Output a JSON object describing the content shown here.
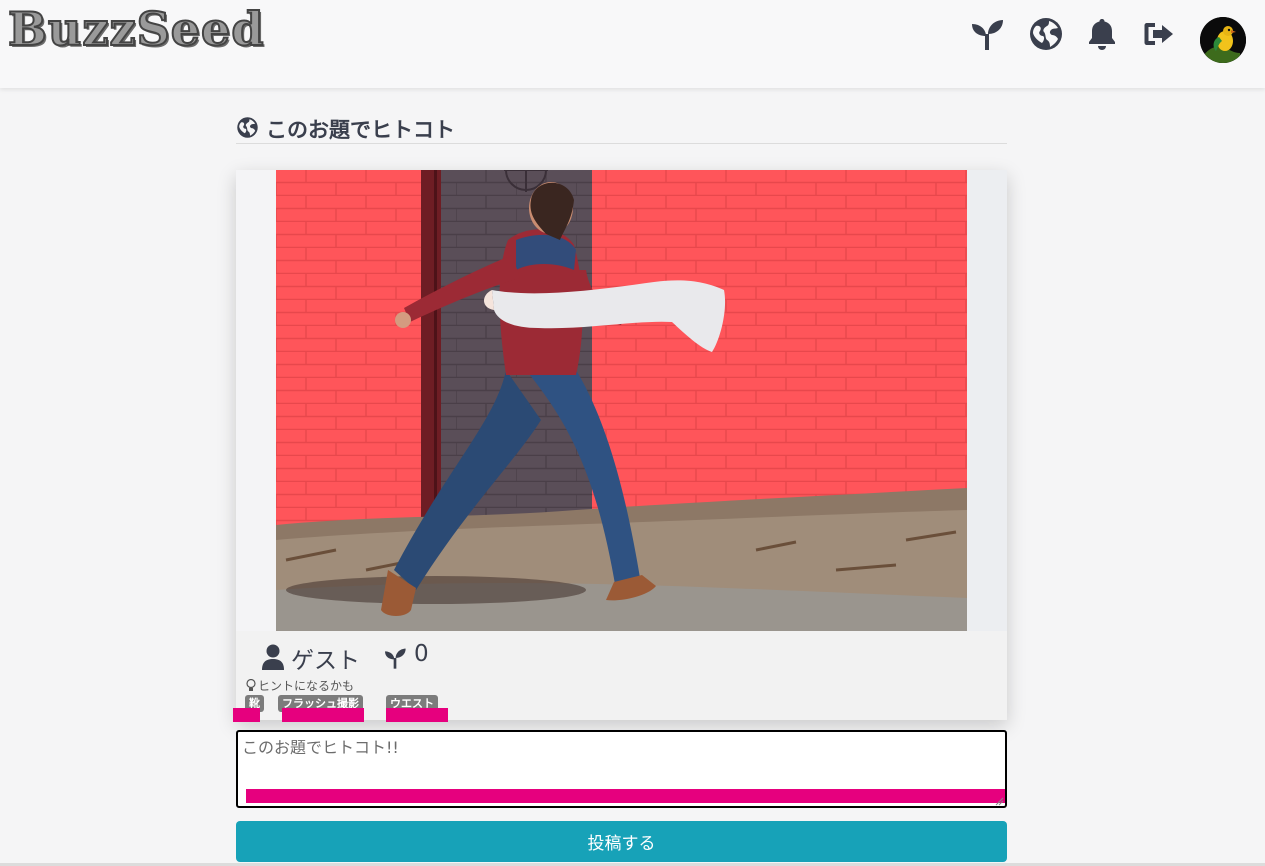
{
  "app": {
    "logo_text": "BuzzSeed"
  },
  "nav": {
    "icons": [
      "sprout-icon",
      "globe-icon",
      "bell-icon",
      "logout-icon"
    ],
    "avatar": "user-avatar"
  },
  "section": {
    "title": "このお題でヒトコト",
    "icon": "globe-icon"
  },
  "post": {
    "image": "photo of a woman carrying a mannequin leg in front of a red brick wall",
    "author": "ゲスト",
    "likes": "0",
    "hint_label": "ヒントになるかも",
    "tags": [
      "靴",
      "フラッシュ撮影",
      "ウエスト"
    ]
  },
  "comment": {
    "placeholder": "このお題でヒトコト!!",
    "value": ""
  },
  "submit": {
    "label": "投稿する"
  },
  "colors": {
    "accent": "#17a2b8",
    "highlight": "#e6007e",
    "tag_bg": "#7c7c7c",
    "icon": "#3a3f4d"
  }
}
